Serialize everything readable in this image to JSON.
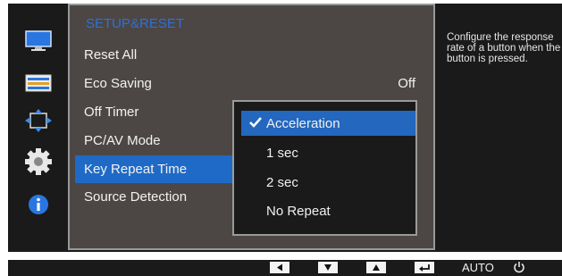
{
  "colors": {
    "panel_bg": "#4c4744",
    "selected_bg": "#1f6ac6",
    "title_color": "#2f6fd8",
    "osd_bg": "#1a1a1a"
  },
  "sidebar": {
    "items": [
      {
        "icon": "monitor-icon"
      },
      {
        "icon": "picture-icon"
      },
      {
        "icon": "position-arrows-icon"
      },
      {
        "icon": "gear-icon"
      },
      {
        "icon": "info-icon"
      }
    ]
  },
  "menu": {
    "title": "SETUP&RESET",
    "items": [
      {
        "label": "Reset All",
        "value": ""
      },
      {
        "label": "Eco Saving",
        "value": "Off"
      },
      {
        "label": "Off Timer",
        "value": ""
      },
      {
        "label": "PC/AV Mode",
        "value": ""
      },
      {
        "label": "Key Repeat Time",
        "value": "",
        "selected": true
      },
      {
        "label": "Source Detection",
        "value": ""
      }
    ]
  },
  "dropdown": {
    "options": [
      {
        "label": "Acceleration",
        "selected": true
      },
      {
        "label": "1 sec"
      },
      {
        "label": "2 sec"
      },
      {
        "label": "No Repeat"
      }
    ]
  },
  "help": {
    "text": "Configure the response rate of a button when the button is pressed."
  },
  "bottom_bar": {
    "keys": [
      "left-arrow-icon",
      "down-arrow-icon",
      "up-arrow-icon",
      "enter-icon"
    ],
    "auto_label": "AUTO",
    "power_icon": "power-icon"
  }
}
